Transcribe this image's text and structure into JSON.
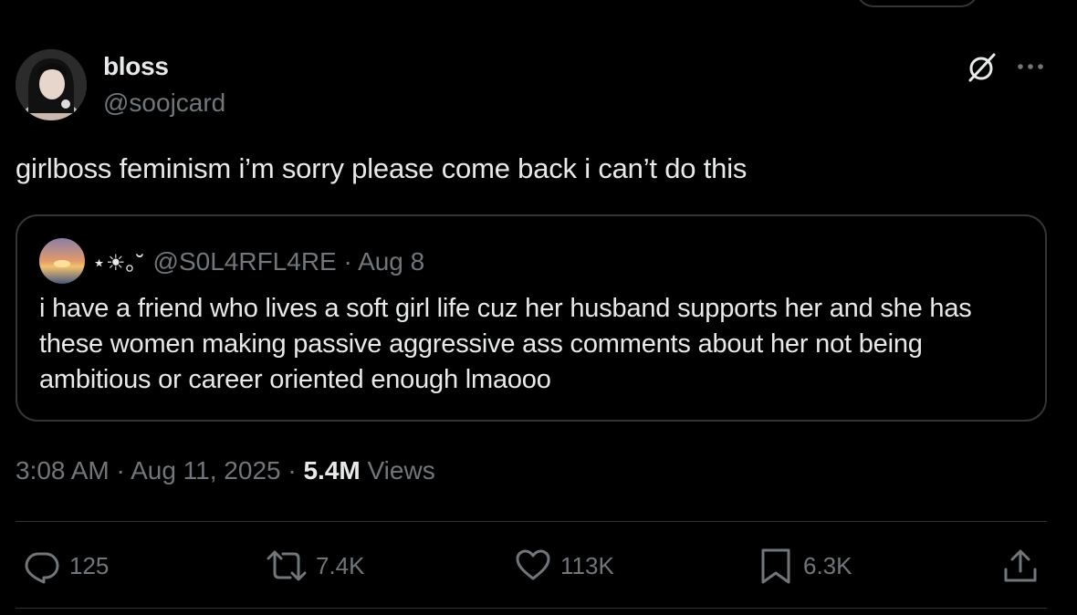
{
  "author": {
    "display_name": "bloss",
    "handle": "@soojcard"
  },
  "tweet": {
    "text": "girlboss feminism i’m sorry please come back i can’t do this"
  },
  "quoted_tweet": {
    "display_name": "⋆☀︎｡˘",
    "handle": "@S0L4RFL4RE",
    "date": "Aug 8",
    "text": "i have a friend who lives a soft girl life cuz her husband supports her and she has these women making passive aggressive ass comments about her not being ambitious or career oriented enough lmaooo"
  },
  "meta": {
    "time": "3:08 AM",
    "date": "Aug 11, 2025",
    "views_count": "5.4M",
    "views_label": "Views"
  },
  "actions": {
    "replies": "125",
    "reposts": "7.4K",
    "likes": "113K",
    "bookmarks": "6.3K"
  },
  "icons": {
    "grok": "grok-icon",
    "more": "more-icon",
    "reply": "reply-icon",
    "repost": "repost-icon",
    "like": "heart-icon",
    "bookmark": "bookmark-icon",
    "share": "share-icon"
  },
  "colors": {
    "background": "#000000",
    "text_primary": "#e7e9ea",
    "text_secondary": "#71767b",
    "border": "#333639"
  }
}
